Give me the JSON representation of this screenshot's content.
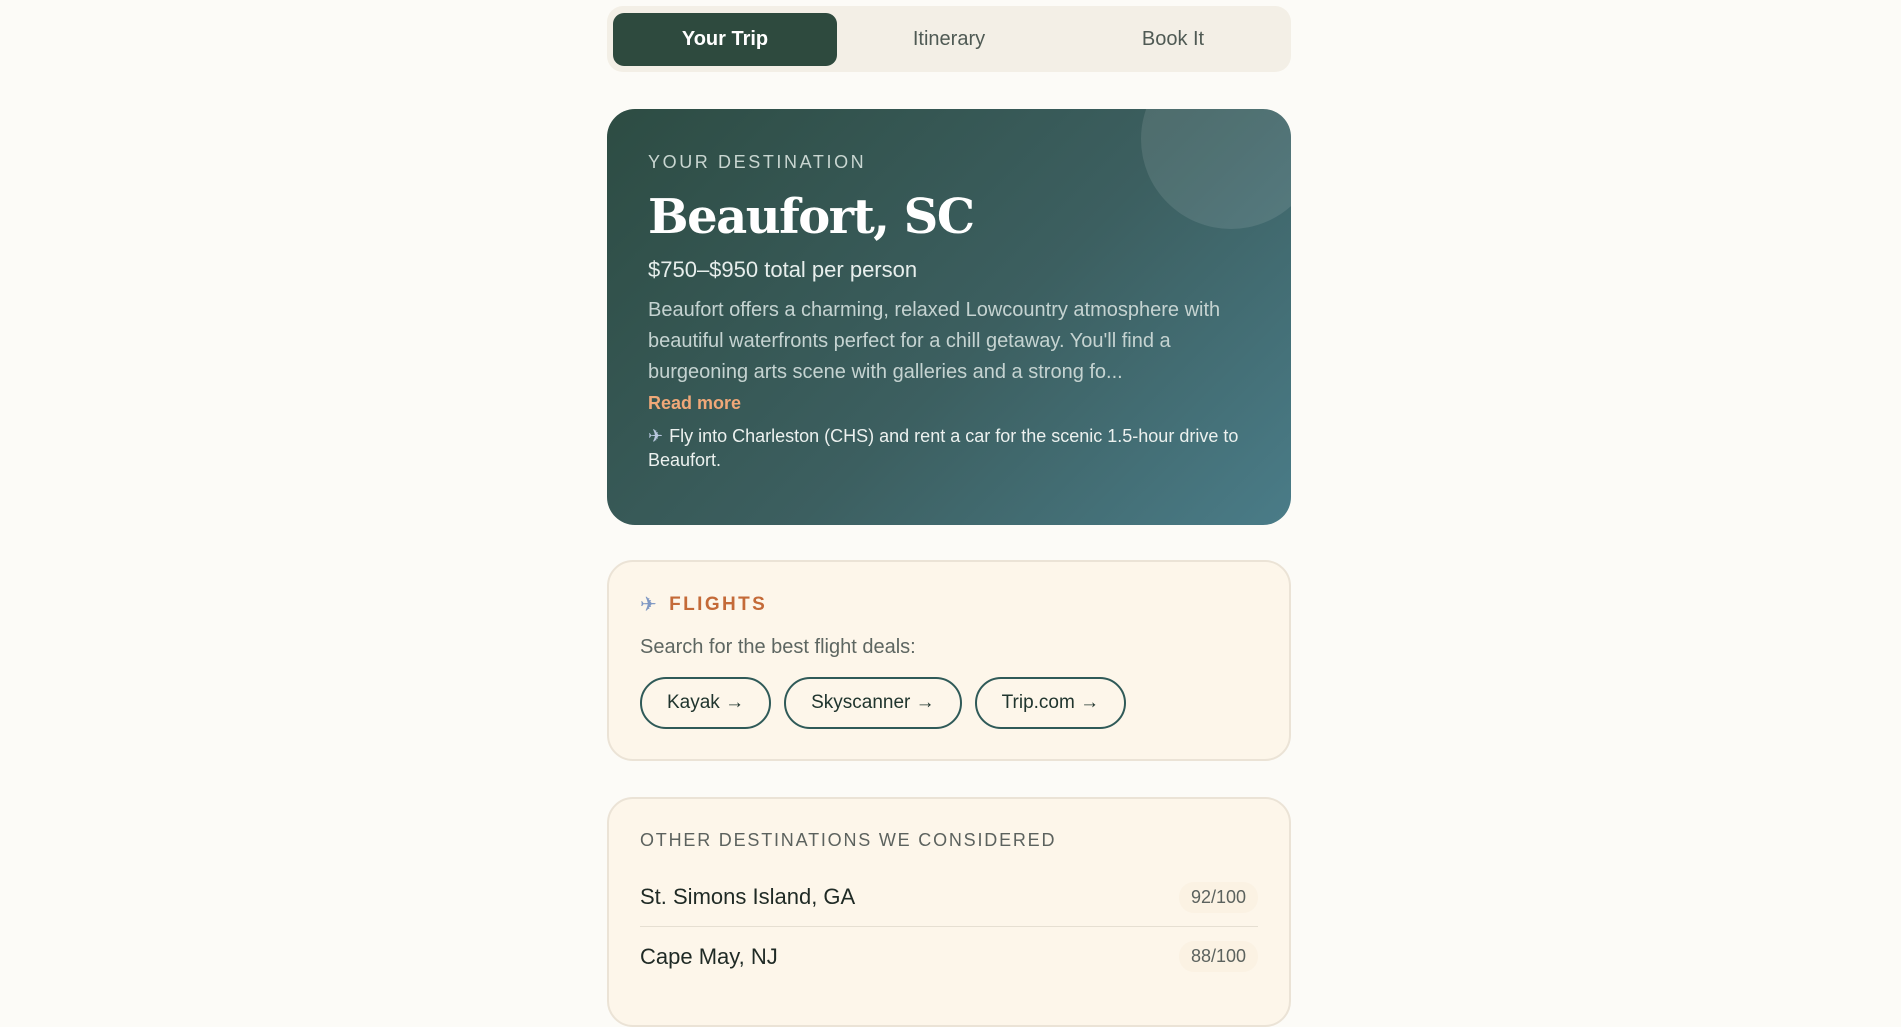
{
  "tabs": [
    {
      "label": "Your Trip",
      "active": true
    },
    {
      "label": "Itinerary",
      "active": false
    },
    {
      "label": "Book It",
      "active": false
    }
  ],
  "hero": {
    "kicker": "YOUR DESTINATION",
    "title": "Beaufort, SC",
    "price": "$750–$950 total per person",
    "description": "Beaufort offers a charming, relaxed Lowcountry atmosphere with beautiful waterfronts perfect for a chill getaway. You'll find a burgeoning arts scene with galleries and a strong fo...",
    "read_more": "Read more",
    "travel_icon": "✈",
    "travel_note": "Fly into Charleston (CHS) and rent a car for the scenic 1.5-hour drive to Beaufort."
  },
  "flights": {
    "icon": "✈",
    "title": "FLIGHTS",
    "subtitle": "Search for the best flight deals:",
    "links": [
      "Kayak →",
      "Skyscanner →",
      "Trip.com →"
    ]
  },
  "others": {
    "title": "OTHER DESTINATIONS WE CONSIDERED",
    "destinations": [
      {
        "name": "St. Simons Island, GA",
        "score": "92/100"
      },
      {
        "name": "Cape May, NJ",
        "score": "88/100"
      }
    ]
  }
}
